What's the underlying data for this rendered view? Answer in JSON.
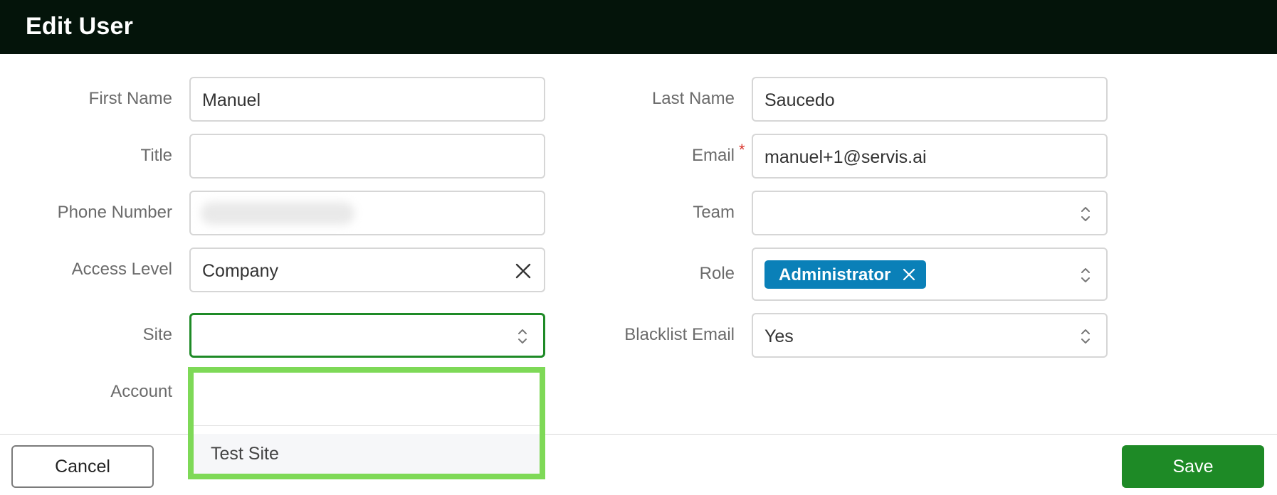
{
  "header": {
    "title": "Edit User"
  },
  "form": {
    "first_name": {
      "label": "First Name",
      "value": "Manuel"
    },
    "last_name": {
      "label": "Last Name",
      "value": "Saucedo"
    },
    "title": {
      "label": "Title",
      "value": ""
    },
    "email": {
      "label": "Email",
      "required_mark": "*",
      "value": "manuel+1@servis.ai"
    },
    "phone": {
      "label": "Phone Number",
      "value": ""
    },
    "team": {
      "label": "Team",
      "value": ""
    },
    "access_level": {
      "label": "Access Level",
      "value": "Company"
    },
    "role": {
      "label": "Role",
      "chip": "Administrator"
    },
    "site": {
      "label": "Site",
      "value": ""
    },
    "blacklist_email": {
      "label": "Blacklist Email",
      "value": "Yes"
    },
    "account": {
      "label": "Account"
    }
  },
  "site_dropdown": {
    "search_value": "",
    "options": [
      "Test Site"
    ]
  },
  "footer": {
    "cancel_label": "Cancel",
    "save_label": "Save"
  },
  "colors": {
    "header_bg": "#04140a",
    "save_green": "#1e8a26",
    "role_chip": "#0a80b8",
    "dropdown_highlight": "#7ed957",
    "required_red": "#d9342b"
  }
}
